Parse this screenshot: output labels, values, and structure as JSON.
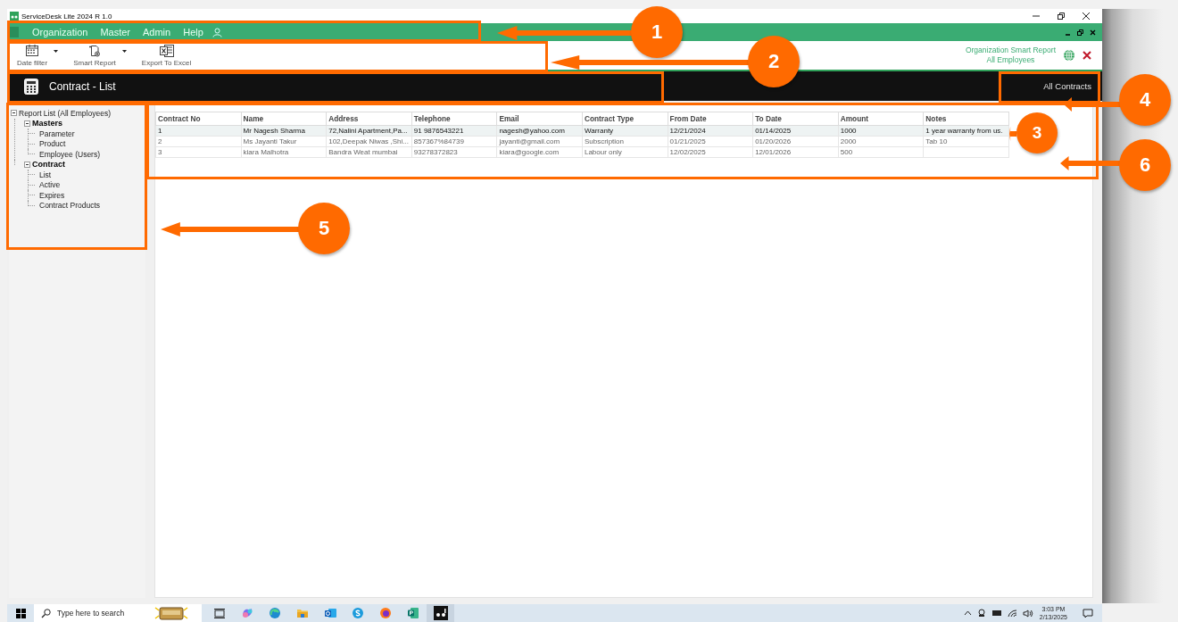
{
  "window": {
    "title": "ServiceDesk Lite 2024 R 1.0"
  },
  "menu": [
    {
      "label": "Organization"
    },
    {
      "label": "Master"
    },
    {
      "label": "Admin"
    },
    {
      "label": "Help"
    }
  ],
  "toolbar": {
    "buttons": [
      {
        "label": "Date filter",
        "kind": "dropdown"
      },
      {
        "label": "Smart Report",
        "kind": "dropdown"
      },
      {
        "label": "Export To Excel",
        "kind": "plain"
      }
    ],
    "report_title": "Organization Smart Report",
    "report_subtitle": "All Employees"
  },
  "header": {
    "title": "Contract - List",
    "filter": "All Contracts"
  },
  "tree": {
    "label": "Report List (All Employees)",
    "expanded": true,
    "children": [
      {
        "label": "Masters",
        "expanded": true,
        "children": [
          {
            "label": "Parameter"
          },
          {
            "label": "Product"
          },
          {
            "label": "Employee (Users)"
          }
        ]
      },
      {
        "label": "Contract",
        "expanded": true,
        "children": [
          {
            "label": "List"
          },
          {
            "label": "Active"
          },
          {
            "label": "Expires"
          },
          {
            "label": "Contract Products"
          }
        ]
      }
    ]
  },
  "table": {
    "columns": [
      "Contract No",
      "Name",
      "Address",
      "Telephone",
      "Email",
      "Contract Type",
      "From Date",
      "To Date",
      "Amount",
      "Notes"
    ],
    "rows": [
      {
        "selected": true,
        "cells": [
          "1",
          "Mr Nagesh Sharma",
          "72,Nalini Apartment,Pa...",
          "91 9876543221",
          "nagesh@yahoo.com",
          "Warranty",
          "12/21/2024",
          "01/14/2025",
          "1000",
          "1 year warranty from us."
        ]
      },
      {
        "selected": false,
        "cells": [
          "2",
          "Ms Jayanti Takur",
          "102,Deepak Niwas ,Shi...",
          "857367%84739",
          "jayanti@gmail.com",
          "Subscription",
          "01/21/2025",
          "01/20/2026",
          "2000",
          "Tab 10"
        ]
      },
      {
        "selected": false,
        "cells": [
          "3",
          "kiara Malhotra",
          "Bandra Weat mumbai",
          "93278372823",
          "kiara@google.com",
          "Labour only",
          "12/02/2025",
          "12/01/2026",
          "500",
          ""
        ]
      }
    ]
  },
  "taskbar": {
    "search_placeholder": "Type here to search",
    "time": "3:03 PM",
    "date": "2/13/2025"
  },
  "callouts": [
    {
      "number": "1"
    },
    {
      "number": "2"
    },
    {
      "number": "3"
    },
    {
      "number": "4"
    },
    {
      "number": "5"
    },
    {
      "number": "6"
    }
  ]
}
